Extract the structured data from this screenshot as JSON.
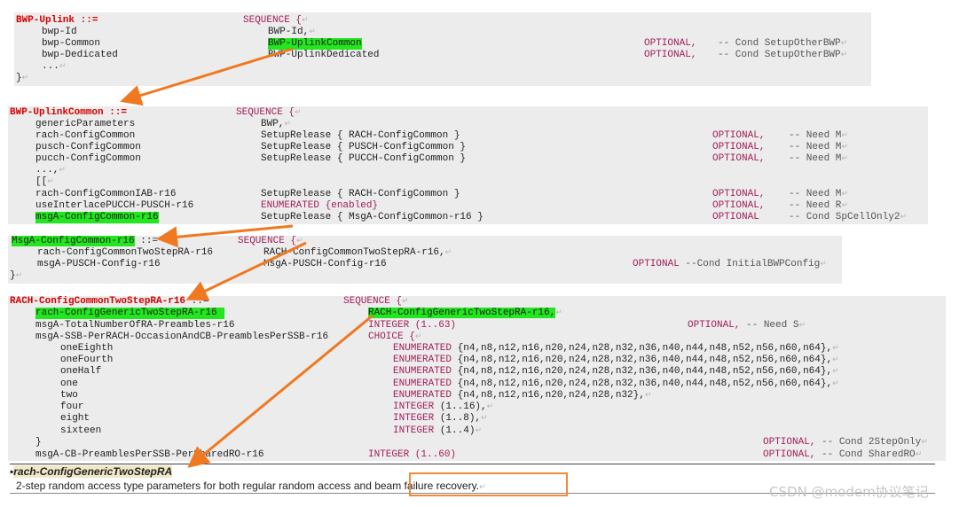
{
  "b1": {
    "title": "BWP-Uplink ::=",
    "seq": "SEQUENCE {",
    "rows": [
      {
        "name": "bwp-Id",
        "type": "BWP-Id,",
        "opt": "",
        "cmt": ""
      },
      {
        "name": "bwp-Common",
        "type": "BWP-UplinkCommon",
        "opt": "OPTIONAL,",
        "cmt": "-- Cond SetupOtherBWP"
      },
      {
        "name": "bwp-Dedicated",
        "type": "BWP-UplinkDedicated",
        "opt": "OPTIONAL,",
        "cmt": "-- Cond SetupOtherBWP"
      },
      {
        "name": "...",
        "type": "",
        "opt": "",
        "cmt": ""
      }
    ],
    "close": "}"
  },
  "b2": {
    "title": "BWP-UplinkCommon ::=",
    "seq": "SEQUENCE {",
    "rows": [
      {
        "name": "genericParameters",
        "type": "BWP,",
        "opt": "",
        "cmt": ""
      },
      {
        "name": "rach-ConfigCommon",
        "type": "SetupRelease { RACH-ConfigCommon }",
        "opt": "OPTIONAL,",
        "cmt": "-- Need M"
      },
      {
        "name": "pusch-ConfigCommon",
        "type": "SetupRelease { PUSCH-ConfigCommon }",
        "opt": "OPTIONAL,",
        "cmt": "-- Need M"
      },
      {
        "name": "pucch-ConfigCommon",
        "type": "SetupRelease { PUCCH-ConfigCommon }",
        "opt": "OPTIONAL,",
        "cmt": "-- Need M"
      },
      {
        "name": "...,",
        "type": "",
        "opt": "",
        "cmt": ""
      },
      {
        "name": "[[",
        "type": "",
        "opt": "",
        "cmt": ""
      },
      {
        "name": "rach-ConfigCommonIAB-r16",
        "type": "SetupRelease { RACH-ConfigCommon }",
        "opt": "OPTIONAL,",
        "cmt": "-- Need M"
      },
      {
        "name": "useInterlacePUCCH-PUSCH-r16",
        "type": "ENUMERATED {enabled}",
        "opt": "OPTIONAL,",
        "cmt": "-- Need R"
      },
      {
        "name": "msgA-ConfigCommon-r16",
        "type": "SetupRelease { MsgA-ConfigCommon-r16 }",
        "opt": "OPTIONAL",
        "cmt": "-- Cond SpCellOnly2"
      }
    ]
  },
  "b3": {
    "title": "MsgA-ConfigCommon-r16",
    "assign": " ::=",
    "seq": "SEQUENCE {",
    "rows": [
      {
        "name": "rach-ConfigCommonTwoStepRA-r16",
        "type": "RACH-ConfigCommonTwoStepRA-r16,",
        "opt": "",
        "cmt": ""
      },
      {
        "name": "msgA-PUSCH-Config-r16",
        "type": "MsgA-PUSCH-Config-r16",
        "opt": "OPTIONAL",
        "cmt": "--Cond InitialBWPConfig"
      }
    ],
    "close": "}"
  },
  "b4": {
    "title": "RACH-ConfigCommonTwoStepRA-r16",
    "assign": " ::=",
    "seq": "SEQUENCE {",
    "rows": [
      {
        "name": "rach-ConfigGenericTwoStepRA-r16",
        "type": "RACH-ConfigGenericTwoStepRA-r16,",
        "opt": "",
        "cmt": ""
      },
      {
        "name": "msgA-TotalNumberOfRA-Preambles-r16",
        "type": "INTEGER (1..63)",
        "opt": "OPTIONAL,",
        "cmt": "-- Need S"
      },
      {
        "name": "msgA-SSB-PerRACH-OccasionAndCB-PreamblesPerSSB-r16",
        "type": "CHOICE {",
        "opt": "",
        "cmt": ""
      }
    ],
    "choice": [
      {
        "name": "oneEighth",
        "kw": "ENUMERATED",
        "val": " {n4,n8,n12,n16,n20,n24,n28,n32,n36,n40,n44,n48,n52,n56,n60,n64},"
      },
      {
        "name": "oneFourth",
        "kw": "ENUMERATED",
        "val": " {n4,n8,n12,n16,n20,n24,n28,n32,n36,n40,n44,n48,n52,n56,n60,n64},"
      },
      {
        "name": "oneHalf",
        "kw": "ENUMERATED",
        "val": " {n4,n8,n12,n16,n20,n24,n28,n32,n36,n40,n44,n48,n52,n56,n60,n64},"
      },
      {
        "name": "one",
        "kw": "ENUMERATED",
        "val": " {n4,n8,n12,n16,n20,n24,n28,n32,n36,n40,n44,n48,n52,n56,n60,n64},"
      },
      {
        "name": "two",
        "kw": "ENUMERATED",
        "val": " {n4,n8,n12,n16,n20,n24,n28,n32},"
      },
      {
        "name": "four",
        "kw": "INTEGER",
        "val": " (1..16),"
      },
      {
        "name": "eight",
        "kw": "INTEGER",
        "val": " (1..8),"
      },
      {
        "name": "sixteen",
        "kw": "INTEGER",
        "val": " (1..4)"
      }
    ],
    "choice_close": "}",
    "choice_opt": "OPTIONAL,",
    "choice_cmt": "-- Cond 2StepOnly",
    "last": {
      "name": "msgA-CB-PreamblesPerSSB-PerSharedRO-r16",
      "type": "INTEGER (1..60)",
      "opt": "OPTIONAL,",
      "cmt": "-- Cond SharedRO"
    }
  },
  "definition": {
    "bullet": "▪",
    "term": "rach-ConfigGenericTwoStepRA",
    "desc": "2-step random access type parameters for both regular random access and beam failure recovery."
  },
  "return_mark": "↵",
  "watermark": "CSDN @modem协议笔记",
  "colors": {
    "highlight": "#22e61e",
    "arrow": "#f07820",
    "title": "#d40000",
    "keyword": "#a0205a"
  }
}
